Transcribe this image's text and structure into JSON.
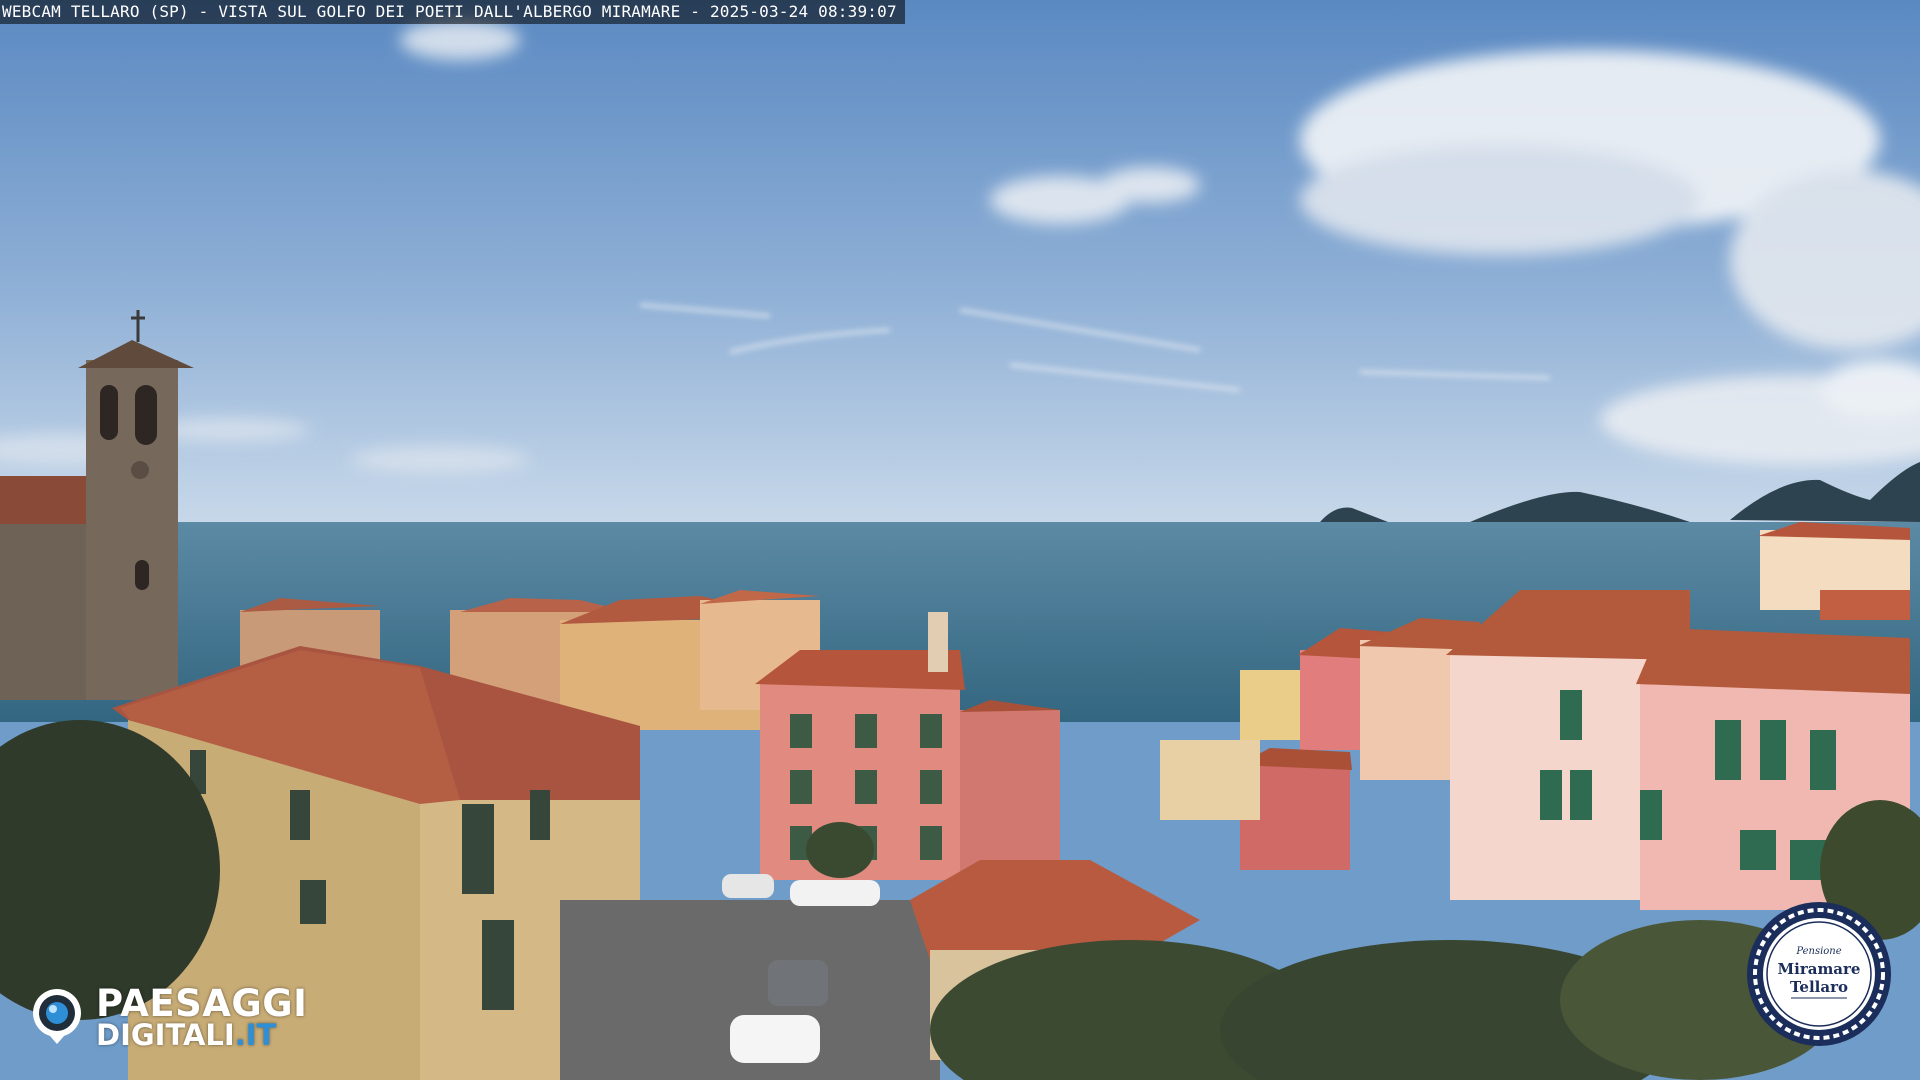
{
  "overlay": {
    "caption": "WEBCAM TELLARO (SP) - VISTA SUL GOLFO DEI POETI DALL'ALBERGO MIRAMARE - 2025-03-24 08:39:07"
  },
  "logo_left": {
    "line1": "PAESAGGI",
    "line2": "DIGITALI",
    "line2_suffix": ".IT",
    "accent_color": "#2f8fd6"
  },
  "logo_right": {
    "line1": "Pensione",
    "line2": "Miramare",
    "line3": "Tellaro",
    "ring_color": "#1b2d5a"
  },
  "scene_colors": {
    "sky_top": "#5b8bc4",
    "sky_horizon": "#c4d6e8",
    "sea": "#3d6f8a",
    "roof": "#b5563c",
    "wall_pink": "#e08a80",
    "wall_yellow": "#d8b878"
  }
}
